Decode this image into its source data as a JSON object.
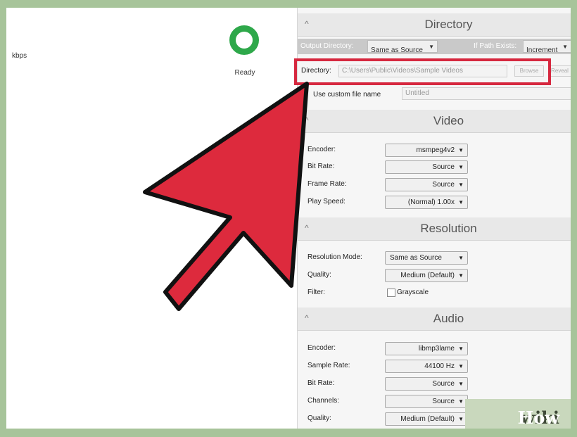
{
  "left": {
    "kbps_label": "kbps",
    "status_label": "Ready"
  },
  "directory_section": {
    "caret": "^",
    "title": "Directory",
    "output_directory_label": "Output Directory:",
    "output_directory_value": "Same as Source",
    "if_path_exists_label": "If Path Exists:",
    "if_path_exists_value": "Increment",
    "directory_label": "Directory:",
    "directory_value": "C:\\Users\\Public\\Videos\\Sample Videos",
    "browse_label": "Browse",
    "reveal_label": "Reveal",
    "custom_name_label": "Use custom file name",
    "custom_name_placeholder": "Untitled"
  },
  "video_section": {
    "caret": "^",
    "title": "Video",
    "rows": [
      {
        "label": "Encoder:",
        "value": "msmpeg4v2"
      },
      {
        "label": "Bit Rate:",
        "value": "Source"
      },
      {
        "label": "Frame Rate:",
        "value": "Source"
      },
      {
        "label": "Play Speed:",
        "value": "(Normal) 1.00x"
      }
    ]
  },
  "resolution_section": {
    "caret": "^",
    "title": "Resolution",
    "rows": [
      {
        "label": "Resolution Mode:",
        "value": "Same as Source"
      },
      {
        "label": "Quality:",
        "value": "Medium (Default)"
      }
    ],
    "filter_label": "Filter:",
    "grayscale_label": "Grayscale"
  },
  "audio_section": {
    "caret": "^",
    "title": "Audio",
    "rows": [
      {
        "label": "Encoder:",
        "value": "libmp3lame"
      },
      {
        "label": "Sample Rate:",
        "value": "44100 Hz"
      },
      {
        "label": "Bit Rate:",
        "value": "Source"
      },
      {
        "label": "Channels:",
        "value": "Source"
      },
      {
        "label": "Quality:",
        "value": "Medium (Default)"
      }
    ]
  },
  "watermark": {
    "part1": "wiki",
    "part2": "How"
  },
  "colors": {
    "arrow_fill": "#dd2a3d",
    "highlight": "#d6283f",
    "ready_ring": "#2ea84a",
    "frame_bg": "#a7c49a"
  },
  "icons": {
    "dropdown_arrow": "▼",
    "collapse_caret": "^"
  }
}
